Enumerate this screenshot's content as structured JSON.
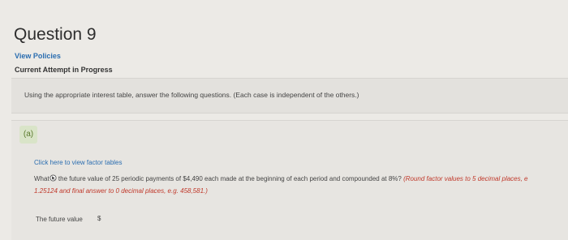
{
  "question": {
    "title": "Question 9",
    "view_policies": "View Policies",
    "attempt_status": "Current Attempt in Progress"
  },
  "instructions": "Using the appropriate interest table, answer the following questions. (Each case is independent of the others.)",
  "part": {
    "label": "(a)",
    "factor_link": "Click here to view factor tables",
    "question_prefix": "What",
    "question_text": " the future value of 25 periodic payments of $4,490 each made at the beginning of each period and compounded at 8%? ",
    "rounding_note_1": "(Round factor values to 5 decimal places, e",
    "rounding_note_2": "1.25124 and final answer to 0 decimal places, e.g. 458,581.)",
    "answer_label": "The future value",
    "answer_currency": "$",
    "answer_value": ""
  }
}
